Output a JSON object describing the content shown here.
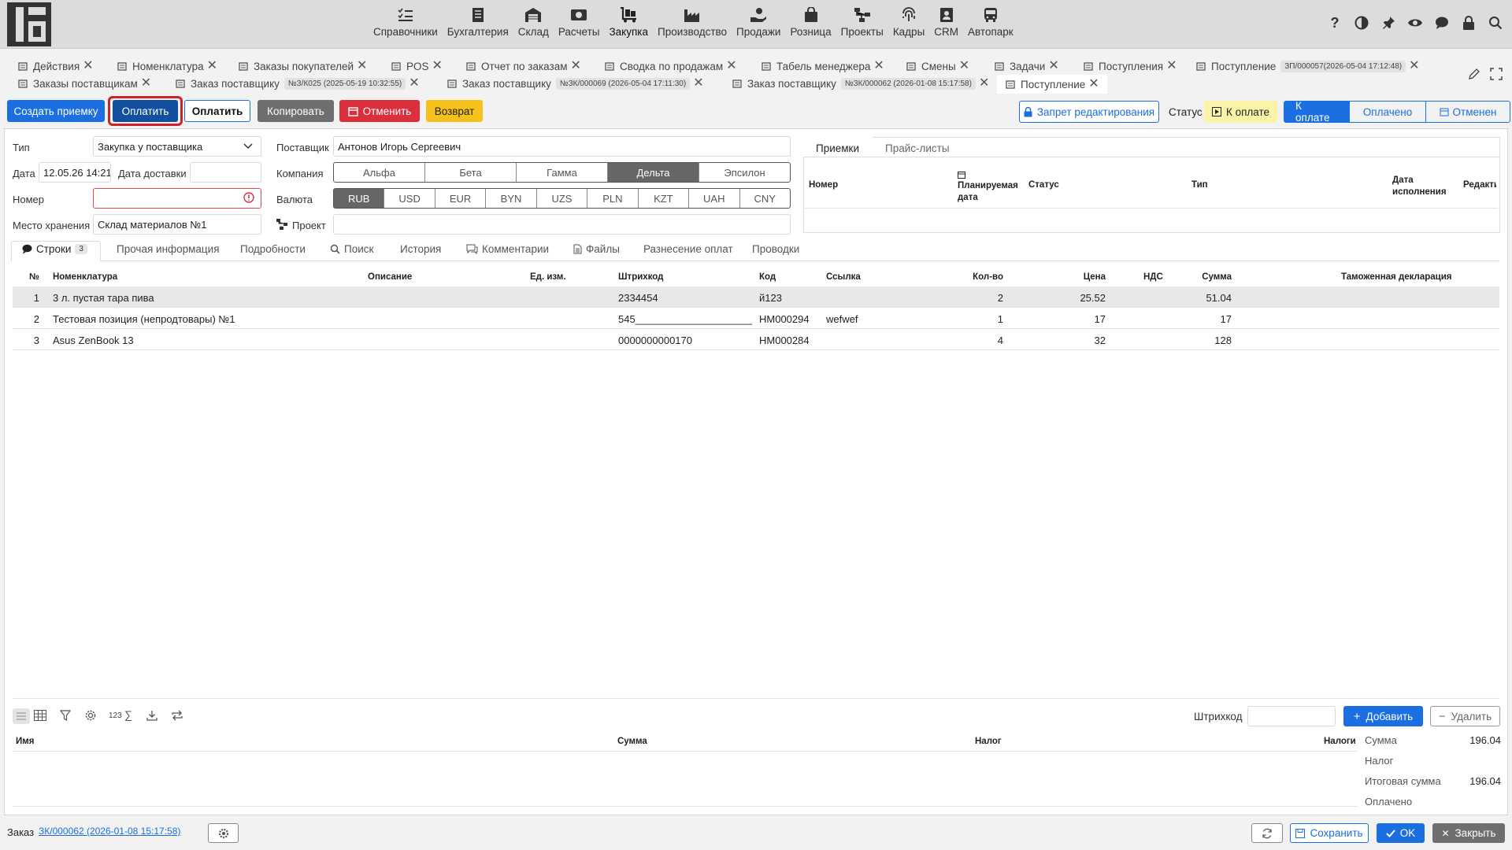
{
  "nav": [
    {
      "label": "Справочники",
      "icon": "list-check-icon"
    },
    {
      "label": "Бухгалтерия",
      "icon": "ledger-icon"
    },
    {
      "label": "Склад",
      "icon": "warehouse-icon"
    },
    {
      "label": "Расчеты",
      "icon": "cash-icon"
    },
    {
      "label": "Закупка",
      "icon": "cart-dolly-icon"
    },
    {
      "label": "Производство",
      "icon": "factory-icon"
    },
    {
      "label": "Продажи",
      "icon": "hand-coin-icon"
    },
    {
      "label": "Розница",
      "icon": "bag-icon"
    },
    {
      "label": "Проекты",
      "icon": "project-icon"
    },
    {
      "label": "Кадры",
      "icon": "fingerprint-icon"
    },
    {
      "label": "CRM",
      "icon": "contact-card-icon"
    },
    {
      "label": "Автопарк",
      "icon": "bus-icon"
    }
  ],
  "tabs_row1": [
    {
      "label": "Действия"
    },
    {
      "label": "Номенклатура"
    },
    {
      "label": "Заказы покупателей"
    },
    {
      "label": "POS"
    },
    {
      "label": "Отчет по заказам"
    },
    {
      "label": "Сводка по продажам"
    },
    {
      "label": "Табель менеджера"
    },
    {
      "label": "Смены"
    },
    {
      "label": "Задачи"
    },
    {
      "label": "Поступления"
    },
    {
      "label": "Поступление",
      "badge": "ЗП/000057(2026-05-04 17:12:48)"
    }
  ],
  "tabs_row2": [
    {
      "label": "Заказы поставщикам"
    },
    {
      "label": "Заказ поставщику",
      "badge": "№З/К025 (2025-05-19 10:32:55)"
    },
    {
      "label": "Заказ поставщику",
      "badge": "№ЗК/000069 (2026-05-04 17:11:30)"
    },
    {
      "label": "Заказ поставщику",
      "badge": "№ЗК/000062 (2026-01-08 15:17:58)"
    },
    {
      "label": "Поступление"
    }
  ],
  "toolbar": {
    "create_receipt": "Создать приемку",
    "pay_primary": "Оплатить",
    "pay_secondary": "Оплатить",
    "copy": "Копировать",
    "cancel": "Отменить",
    "return": "Возврат",
    "edit_lock": "Запрет редактирования",
    "status_label": "Статус",
    "status_value": "К оплате",
    "flow": [
      "К оплате",
      "Оплачено",
      "Отменен"
    ]
  },
  "form": {
    "type_label": "Тип",
    "type_value": "Закупка у поставщика",
    "date_label": "Дата",
    "date_value": "12.05.26 14:21",
    "delivery_label": "Дата доставки",
    "delivery_value": "",
    "number_label": "Номер",
    "number_value": "",
    "storage_label": "Место хранения",
    "storage_value": "Склад материалов №1",
    "supplier_label": "Поставщик",
    "supplier_value": "Антонов Игорь Сергеевич",
    "company_label": "Компания",
    "companies": [
      "Альфа",
      "Бета",
      "Гамма",
      "Дельта",
      "Эпсилон"
    ],
    "company_selected": "Дельта",
    "currency_label": "Валюта",
    "currencies": [
      "RUB",
      "USD",
      "EUR",
      "BYN",
      "UZS",
      "PLN",
      "KZT",
      "UAH",
      "CNY"
    ],
    "currency_selected": "RUB",
    "project_label": "Проект",
    "project_value": ""
  },
  "right_panel": {
    "tabs": [
      "Приемки",
      "Прайс-листы"
    ],
    "columns": [
      "Номер",
      "Планируемая дата",
      "Статус",
      "Тип",
      "Дата исполнения",
      "Редакти"
    ]
  },
  "subtabs": [
    {
      "label": "Строки",
      "count": "3"
    },
    {
      "label": "Прочая информация"
    },
    {
      "label": "Подробности"
    },
    {
      "label": "Поиск"
    },
    {
      "label": "История"
    },
    {
      "label": "Комментарии"
    },
    {
      "label": "Файлы"
    },
    {
      "label": "Разнесение оплат"
    },
    {
      "label": "Проводки"
    }
  ],
  "lines": {
    "columns": [
      "№",
      "Номенклатура",
      "Описание",
      "Ед. изм.",
      "Штрихкод",
      "Код",
      "Ссылка",
      "Кол-во",
      "Цена",
      "НДС",
      "Сумма",
      "Таможенная декларация"
    ],
    "rows": [
      {
        "n": "1",
        "name": "3 л. пустая тара пива",
        "desc": "",
        "unit": "",
        "barcode": "2334454",
        "code": "й123",
        "link": "",
        "qty": "2",
        "price": "25.52",
        "vat": "",
        "sum": "51.04",
        "customs": ""
      },
      {
        "n": "2",
        "name": "Тестовая позиция (непродтовары) №1",
        "desc": "",
        "unit": "",
        "barcode": "545______________________...",
        "code": "НМ000294",
        "link": "wefwef",
        "qty": "1",
        "price": "17",
        "vat": "",
        "sum": "17",
        "customs": ""
      },
      {
        "n": "3",
        "name": "Asus ZenBook 13",
        "desc": "",
        "unit": "",
        "barcode": "0000000000170",
        "code": "НМ000284",
        "link": "",
        "qty": "4",
        "price": "32",
        "vat": "",
        "sum": "128",
        "customs": ""
      }
    ]
  },
  "lines_tools": {
    "barcode_label": "Штрихкод",
    "add": "Добавить",
    "delete": "Удалить",
    "sum_mode": "123"
  },
  "taxes": {
    "columns": [
      "Имя",
      "Сумма",
      "Налог",
      "Налоги"
    ]
  },
  "totals": {
    "sum_label": "Сумма",
    "sum_value": "196.04",
    "tax_label": "Налог",
    "tax_value": "",
    "total_label": "Итоговая сумма",
    "total_value": "196.04",
    "paid_label": "Оплачено",
    "paid_value": ""
  },
  "footer": {
    "order_label": "Заказ",
    "order_link": "ЗК/000062 (2026-01-08 15:17:58)",
    "save": "Сохранить",
    "ok": "OK",
    "close": "Закрыть"
  },
  "colors": {
    "accent": "#1b6fe0",
    "danger": "#dc2f3e",
    "warning": "#f5c11a",
    "highlight_ring": "#d0202a"
  }
}
